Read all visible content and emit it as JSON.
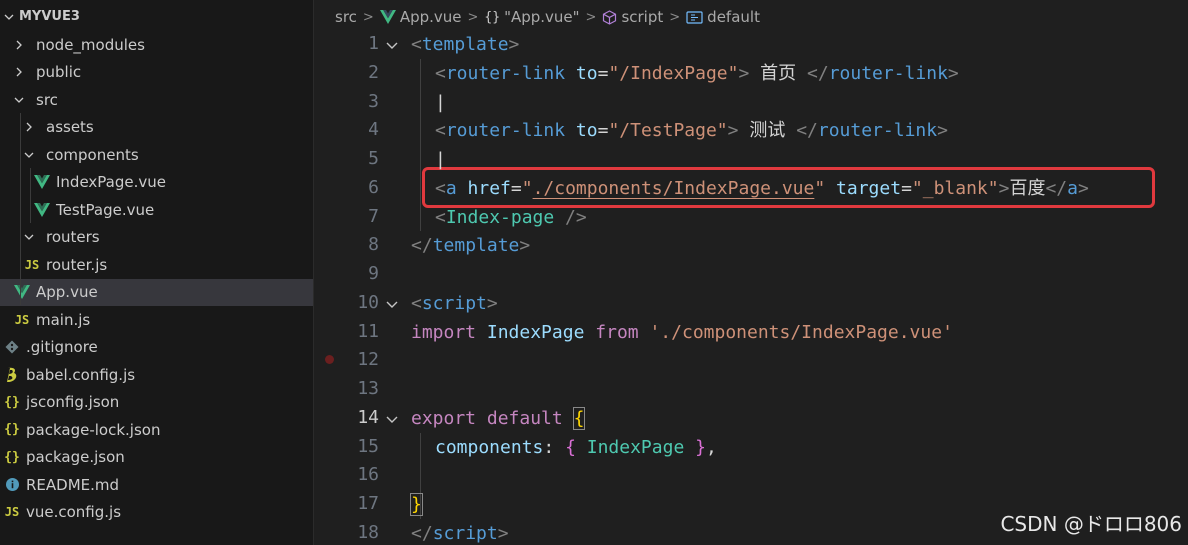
{
  "explorer": {
    "root": "MYVUE3",
    "items": [
      {
        "label": "node_modules",
        "kind": "folder-closed"
      },
      {
        "label": "public",
        "kind": "folder-closed"
      },
      {
        "label": "src",
        "kind": "folder-open"
      },
      {
        "label": "assets",
        "kind": "folder-closed"
      },
      {
        "label": "components",
        "kind": "folder-open"
      },
      {
        "label": "IndexPage.vue",
        "kind": "vue-file"
      },
      {
        "label": "TestPage.vue",
        "kind": "vue-file"
      },
      {
        "label": "routers",
        "kind": "folder-open"
      },
      {
        "label": "router.js",
        "kind": "js-file"
      },
      {
        "label": "App.vue",
        "kind": "vue-file",
        "selected": true
      },
      {
        "label": "main.js",
        "kind": "js-file"
      },
      {
        "label": ".gitignore",
        "kind": "git-file"
      },
      {
        "label": "babel.config.js",
        "kind": "babel-file"
      },
      {
        "label": "jsconfig.json",
        "kind": "json-file"
      },
      {
        "label": "package-lock.json",
        "kind": "json-file"
      },
      {
        "label": "package.json",
        "kind": "json-file"
      },
      {
        "label": "README.md",
        "kind": "info-file"
      },
      {
        "label": "vue.config.js",
        "kind": "js-file"
      }
    ],
    "icon_glyphs": {
      "js": "JS",
      "json": "{}"
    }
  },
  "breadcrumb": {
    "items": [
      "src",
      "App.vue",
      "\"App.vue\"",
      "script",
      "default"
    ],
    "separator": ">"
  },
  "editor": {
    "line_numbers": [
      "1",
      "2",
      "3",
      "4",
      "5",
      "6",
      "7",
      "8",
      "9",
      "10",
      "11",
      "12",
      "13",
      "14",
      "15",
      "16",
      "17",
      "18"
    ],
    "active_line": "14",
    "lines": {
      "l1": {
        "open": "<",
        "tag": "template",
        "close": ">"
      },
      "l2": {
        "open": "<",
        "tag": "router-link",
        "attr": "to",
        "eq": "=",
        "val": "\"/IndexPage\"",
        "close": ">",
        "text": " 首页 ",
        "endopen": "</",
        "endtag": "router-link",
        "endclose": ">"
      },
      "l3": {
        "text": "|"
      },
      "l4": {
        "open": "<",
        "tag": "router-link",
        "attr": "to",
        "eq": "=",
        "val": "\"/TestPage\"",
        "close": ">",
        "text": " 测试 ",
        "endopen": "</",
        "endtag": "router-link",
        "endclose": ">"
      },
      "l5": {
        "text": "|"
      },
      "l6": {
        "open": "<",
        "tag": "a",
        "attr1": "href",
        "eq1": "=",
        "val1_q1": "\"",
        "val1_path": "./components/IndexPage.vue",
        "val1_q2": "\"",
        "attr2": "target",
        "eq2": "=",
        "val2": "\"_blank\"",
        "close": ">",
        "text": "百度",
        "endopen": "</",
        "endtag": "a",
        "endclose": ">"
      },
      "l7": {
        "open": "<",
        "tag": "Index-page",
        "close": " />"
      },
      "l8": {
        "open": "</",
        "tag": "template",
        "close": ">"
      },
      "l10": {
        "open": "<",
        "tag": "script",
        "close": ">"
      },
      "l11": {
        "kw": "import",
        "name": "IndexPage",
        "kw2": "from",
        "str": "'./components/IndexPage.vue'"
      },
      "l14": {
        "kw": "export",
        "kw2": "default",
        "brace": "{"
      },
      "l15": {
        "key": "components",
        "colon": ":",
        "b1": "{",
        "name": "IndexPage",
        "b2": "}",
        "comma": ","
      },
      "l17": {
        "brace": "}"
      },
      "l18": {
        "open": "</",
        "tag": "script",
        "close": ">"
      }
    }
  },
  "credit": "CSDN @ドロロ806",
  "colors": {
    "highlight_border": "#e0393e",
    "vue_green": "#41b883",
    "tag_blue": "#569cd6",
    "string_orange": "#ce9178"
  }
}
